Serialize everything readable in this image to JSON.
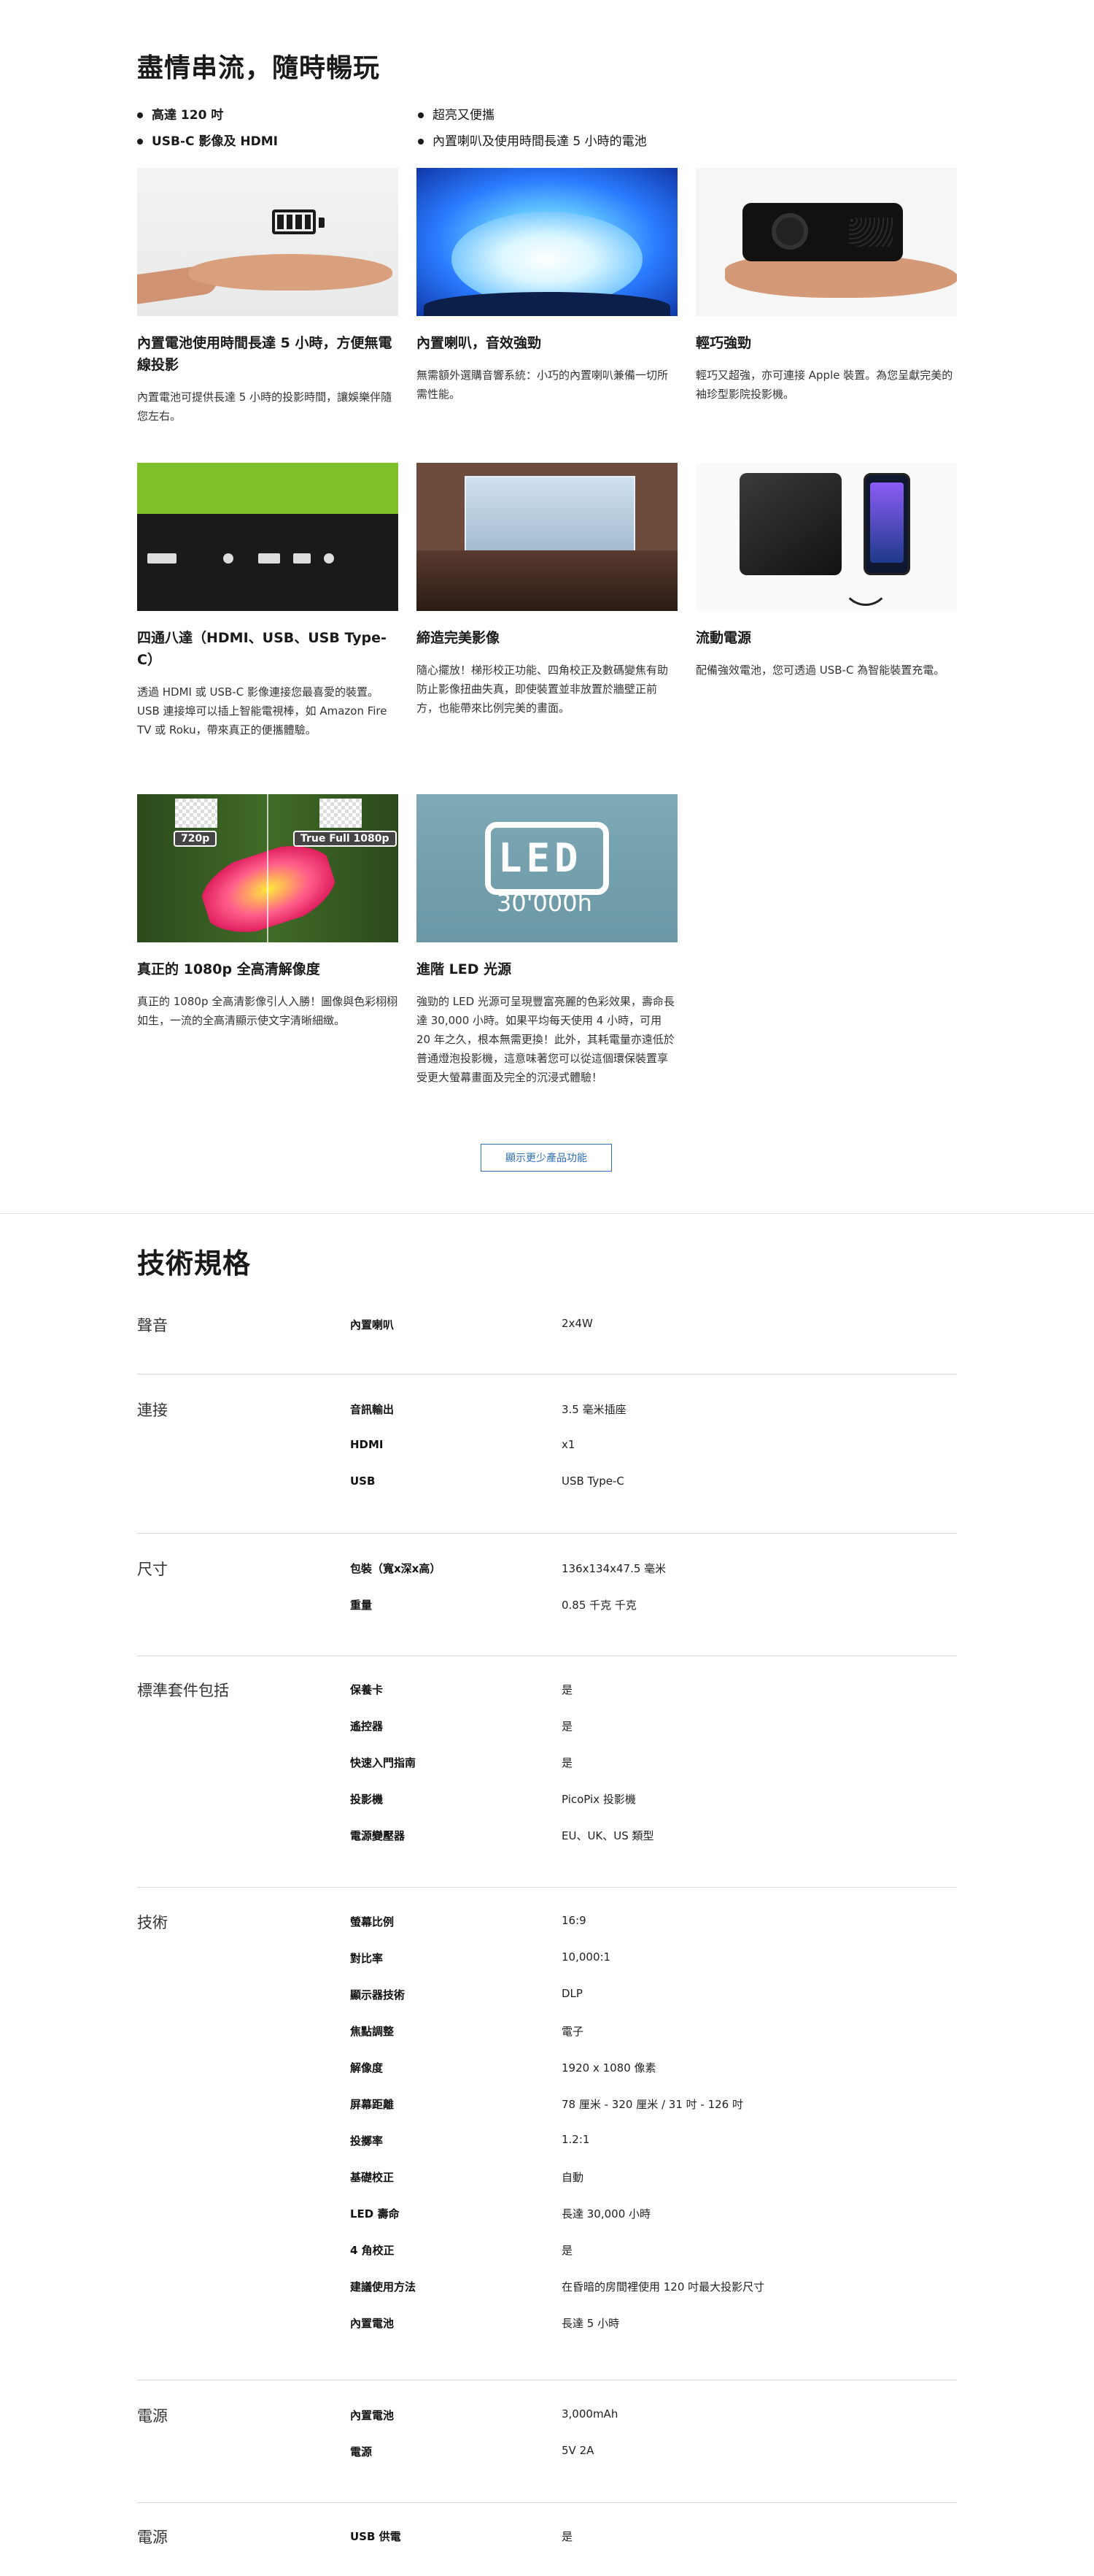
{
  "hero": {
    "title": "盡情串流，隨時暢玩",
    "bullets_left": [
      "高達 120 吋",
      "USB-C 影像及 HDMI"
    ],
    "bullets_right": [
      "超亮又便攜",
      "內置喇叭及使用時間長達 5 小時的電池"
    ]
  },
  "features": [
    {
      "title": "內置電池使用時間長達 5 小時，方便無電線投影",
      "desc": "內置電池可提供長達 5 小時的投影時間，讓娛樂伴隨您左右。",
      "icon": "battery-icon"
    },
    {
      "title": "內置喇叭，音效強勁",
      "desc": "無需額外選購音響系統：小巧的內置喇叭兼備一切所需性能。",
      "icon": "speaker-glow-icon"
    },
    {
      "title": "輕巧強勁",
      "desc": "輕巧又超強，亦可連接 Apple 裝置。為您呈獻完美的袖珍型影院投影機。",
      "icon": "projector-icon"
    },
    {
      "title": "四通八達（HDMI、USB、USB Type-C）",
      "desc": "透過 HDMI 或 USB-C 影像連接您最喜愛的裝置。USB 連接埠可以插上智能電視棒，如 Amazon Fire TV 或 Roku，帶來真正的便攜體驗。",
      "icon": "ports-icon"
    },
    {
      "title": "締造完美影像",
      "desc": "隨心擺放！梯形校正功能、四角校正及數碼變焦有助防止影像扭曲失真，即使裝置並非放置於牆壁正前方，也能帶來比例完美的畫面。",
      "icon": "screen-icon"
    },
    {
      "title": "流動電源",
      "desc": "配備強效電池，您可透過 USB-C 為智能裝置充電。",
      "icon": "powerbank-icon"
    },
    {
      "title": "真正的 1080p 全高清解像度",
      "desc": "真正的 1080p 全高清影像引人入勝！圖像與色彩栩栩如生，一流的全高清顯示使文字清晰細緻。",
      "icon": "flower-icon",
      "tags": [
        "720p",
        "True Full 1080p"
      ]
    },
    {
      "title": "進階 LED 光源",
      "desc": "強勁的 LED 光源可呈現豐富亮麗的色彩效果，壽命長達 30,000 小時。如果平均每天使用 4 小時，可用 20 年之久，根本無需更換！此外，其耗電量亦遠低於普通燈泡投影機，這意味著您可以從這個環保裝置享受更大螢幕畫面及完全的沉浸式體驗！",
      "icon": "led-icon",
      "overlay": [
        "LED",
        "30'000h"
      ]
    }
  ],
  "show_less_label": "顯示更少產品功能",
  "specs_title": "技術規格",
  "specs": [
    {
      "category": "聲音",
      "rows": [
        {
          "k": "內置喇叭",
          "v": "2x4W"
        }
      ]
    },
    {
      "category": "連接",
      "rows": [
        {
          "k": "音訊輸出",
          "v": "3.5 毫米插座"
        },
        {
          "k": "HDMI",
          "v": "x1"
        },
        {
          "k": "USB",
          "v": "USB Type-C"
        }
      ]
    },
    {
      "category": "尺寸",
      "rows": [
        {
          "k": "包裝（寬x深x高）",
          "v": "136x134x47.5 毫米"
        },
        {
          "k": "重量",
          "v": "0.85 千克 千克"
        }
      ]
    },
    {
      "category": "標準套件包括",
      "rows": [
        {
          "k": "保養卡",
          "v": "是"
        },
        {
          "k": "遙控器",
          "v": "是"
        },
        {
          "k": "快速入門指南",
          "v": "是"
        },
        {
          "k": "投影機",
          "v": "PicoPix 投影機"
        },
        {
          "k": "電源變壓器",
          "v": "EU、UK、US 類型"
        }
      ]
    },
    {
      "category": "技術",
      "rows": [
        {
          "k": "螢幕比例",
          "v": "16:9"
        },
        {
          "k": "對比率",
          "v": "10,000:1"
        },
        {
          "k": "顯示器技術",
          "v": "DLP"
        },
        {
          "k": "焦點調整",
          "v": "電子"
        },
        {
          "k": "解像度",
          "v": "1920 x 1080 像素"
        },
        {
          "k": "屏幕距離",
          "v": "78 厘米 - 320 厘米 / 31 吋 - 126 吋"
        },
        {
          "k": "投擲率",
          "v": "1.2:1"
        },
        {
          "k": "基礎校正",
          "v": "自動"
        },
        {
          "k": "LED 壽命",
          "v": "長達 30,000 小時"
        },
        {
          "k": "4 角校正",
          "v": "是"
        },
        {
          "k": "建議使用方法",
          "v": "在昏暗的房間裡使用 120 吋最大投影尺寸"
        },
        {
          "k": "內置電池",
          "v": "長達 5 小時"
        }
      ]
    },
    {
      "category": "電源",
      "rows": [
        {
          "k": "內置電池",
          "v": "3,000mAh"
        },
        {
          "k": "電源",
          "v": "5V 2A"
        }
      ]
    },
    {
      "category": "電源",
      "rows": [
        {
          "k": "USB 供電",
          "v": "是"
        }
      ]
    }
  ]
}
